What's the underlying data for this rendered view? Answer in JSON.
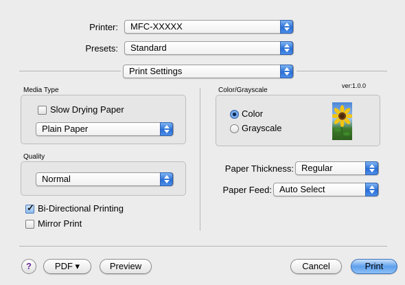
{
  "printer": {
    "label": "Printer:",
    "value": "MFC-XXXXX"
  },
  "presets": {
    "label": "Presets:",
    "value": "Standard"
  },
  "panel": {
    "value": "Print Settings"
  },
  "media": {
    "title": "Media Type",
    "slow_drying_label": "Slow Drying Paper",
    "slow_drying_checked": false,
    "paper_value": "Plain Paper"
  },
  "quality": {
    "title": "Quality",
    "value": "Normal"
  },
  "options": {
    "bidirectional_label": "Bi-Directional Printing",
    "bidirectional_checked": true,
    "mirror_label": "Mirror Print",
    "mirror_checked": false
  },
  "color": {
    "title": "Color/Grayscale",
    "version": "ver:1.0.0",
    "color_label": "Color",
    "grayscale_label": "Grayscale",
    "selected": "Color"
  },
  "paper": {
    "thickness_label": "Paper Thickness:",
    "thickness_value": "Regular",
    "feed_label": "Paper Feed:",
    "feed_value": "Auto Select"
  },
  "buttons": {
    "help": "?",
    "pdf": "PDF ▾",
    "preview": "Preview",
    "cancel": "Cancel",
    "print": "Print"
  },
  "colors": {
    "accent": "#3b7fe0",
    "background": "#ececec"
  }
}
